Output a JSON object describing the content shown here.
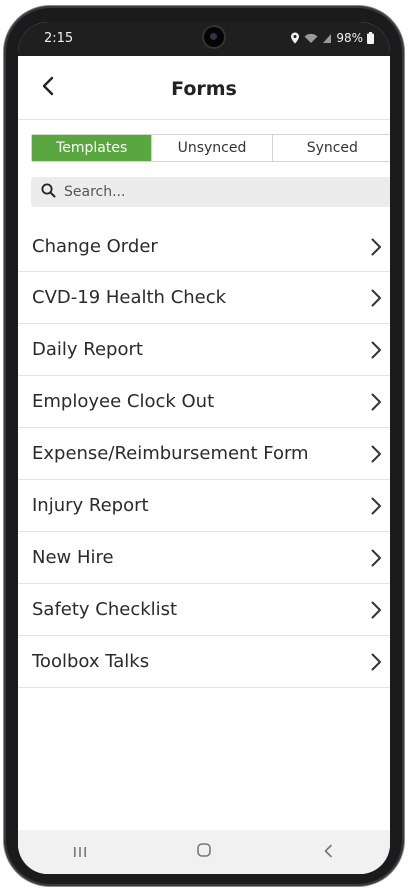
{
  "status_bar": {
    "time": "2:15",
    "battery": "98%",
    "icons": [
      "location-icon",
      "wifi-icon",
      "signal-icon",
      "battery-icon"
    ]
  },
  "header": {
    "title": "Forms",
    "back_icon": "back-chevron-icon"
  },
  "tabs": [
    {
      "label": "Templates",
      "active": true
    },
    {
      "label": "Unsynced",
      "active": false
    },
    {
      "label": "Synced",
      "active": false
    }
  ],
  "search": {
    "placeholder": "Search...",
    "icon": "search-icon"
  },
  "forms": [
    {
      "label": "Change Order"
    },
    {
      "label": "CVD-19 Health Check"
    },
    {
      "label": "Daily Report"
    },
    {
      "label": "Employee Clock Out"
    },
    {
      "label": "Expense/Reimbursement Form"
    },
    {
      "label": "Injury Report"
    },
    {
      "label": "New Hire"
    },
    {
      "label": "Safety Checklist"
    },
    {
      "label": "Toolbox Talks"
    }
  ],
  "nav_bar": {
    "buttons": [
      "recents-icon",
      "home-icon",
      "back-icon"
    ]
  },
  "colors": {
    "accent": "#5aa73f",
    "status_bar_bg": "#1f1f1f",
    "nav_bar_bg": "#f1f1f1"
  }
}
